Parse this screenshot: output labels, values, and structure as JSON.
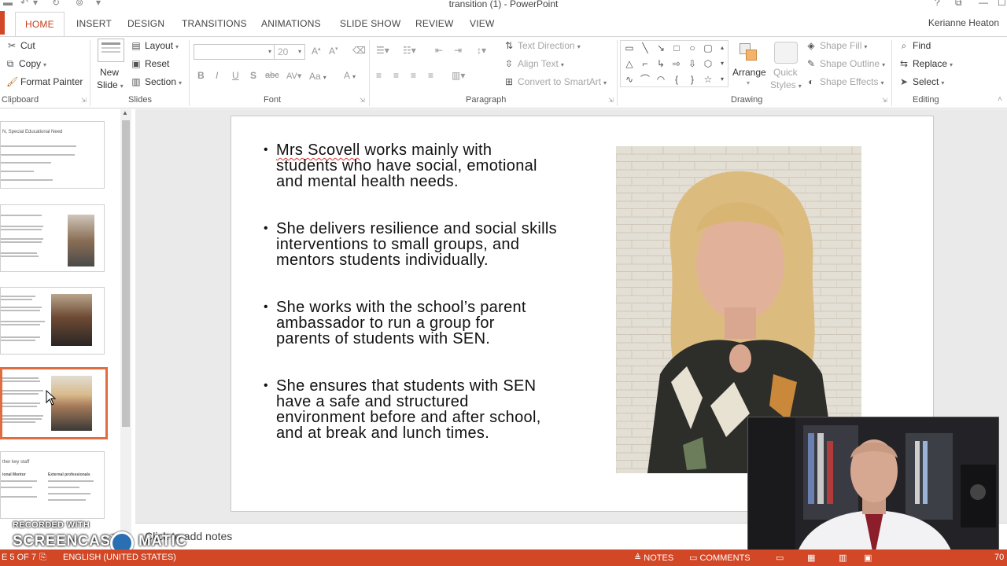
{
  "window": {
    "title": "transition (1) - PowerPoint",
    "help": "?"
  },
  "tabs": [
    "HOME",
    "INSERT",
    "DESIGN",
    "TRANSITIONS",
    "ANIMATIONS",
    "SLIDE SHOW",
    "REVIEW",
    "VIEW"
  ],
  "user": "Kerianne Heaton",
  "ribbon": {
    "clipboard": {
      "cut": "Cut",
      "copy": "Copy",
      "format_painter": "Format Painter",
      "label": "Clipboard"
    },
    "slides": {
      "new_slide_1": "New",
      "new_slide_2": "Slide",
      "layout": "Layout",
      "reset": "Reset",
      "section": "Section",
      "label": "Slides"
    },
    "font": {
      "size": "20",
      "label": "Font",
      "bold": "B",
      "italic": "I",
      "underline": "U",
      "shadow": "S",
      "strike": "abc",
      "case": "Aa",
      "color": "A"
    },
    "paragraph": {
      "text_direction": "Text Direction",
      "align_text": "Align Text",
      "convert_smartart": "Convert to SmartArt",
      "label": "Paragraph"
    },
    "drawing": {
      "arrange": "Arrange",
      "quick_styles_1": "Quick",
      "quick_styles_2": "Styles",
      "shape_fill": "Shape Fill",
      "shape_outline": "Shape Outline",
      "shape_effects": "Shape Effects",
      "label": "Drawing"
    },
    "editing": {
      "find": "Find",
      "replace": "Replace",
      "select": "Select",
      "label": "Editing"
    }
  },
  "thumbnails": {
    "slide1_title": "N, Special Educational Need",
    "slide5_title": "ther key staff",
    "slide5_col1": "ional Mentor",
    "slide5_col2": "External professionals"
  },
  "slide": {
    "bullets": [
      {
        "l1_underlined": "Mrs Scovell",
        "l1_rest": " works mainly with",
        "l2": "students who have social, emotional",
        "l3": "and mental health needs."
      },
      {
        "l1": "She delivers resilience and social skills",
        "l2": "interventions to small groups, and",
        "l3": "mentors students individually."
      },
      {
        "l1": "She works with the school’s parent",
        "l2": "ambassador to run a group for",
        "l3": "parents of students with SEN."
      },
      {
        "l1": "She ensures that students with SEN",
        "l2": "have a safe and structured",
        "l3": "environment before and after school,",
        "l4": "and at break and lunch times."
      }
    ]
  },
  "notes": {
    "placeholder": "Click to add notes"
  },
  "watermark": {
    "line1": "RECORDED WITH",
    "line2": "SCREENCAST",
    "line3": "MATIC"
  },
  "status": {
    "slide_of": "E 5 OF 7",
    "language": "ENGLISH (UNITED STATES)",
    "notes": "NOTES",
    "comments": "COMMENTS",
    "zoom": "70"
  },
  "colors": {
    "accent": "#d24726",
    "selected_thumb": "#e06c3f",
    "active_tab": "#c43e1c"
  }
}
